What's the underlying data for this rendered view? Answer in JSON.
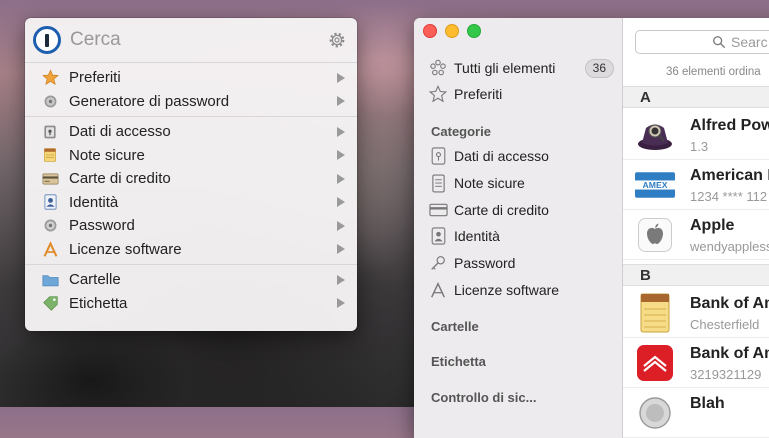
{
  "mini": {
    "search_placeholder": "Cerca",
    "groups": [
      [
        {
          "label": "Preferiti",
          "icon": "star-icon"
        },
        {
          "label": "Generatore di password",
          "icon": "gear-icon"
        }
      ],
      [
        {
          "label": "Dati di accesso",
          "icon": "login-icon"
        },
        {
          "label": "Note sicure",
          "icon": "note-icon"
        },
        {
          "label": "Carte di credito",
          "icon": "credit-card-icon"
        },
        {
          "label": "Identità",
          "icon": "identity-icon"
        },
        {
          "label": "Password",
          "icon": "password-icon"
        },
        {
          "label": "Licenze software",
          "icon": "software-license-icon"
        }
      ],
      [
        {
          "label": "Cartelle",
          "icon": "folder-icon"
        },
        {
          "label": "Etichetta",
          "icon": "tag-icon"
        }
      ]
    ]
  },
  "sidebar": {
    "all_items": {
      "label": "Tutti gli elementi",
      "count": "36"
    },
    "favorites": "Preferiti",
    "categories_header": "Categorie",
    "categories": [
      {
        "label": "Dati di accesso",
        "icon": "login-icon"
      },
      {
        "label": "Note sicure",
        "icon": "note-icon"
      },
      {
        "label": "Carte di credito",
        "icon": "credit-card-icon"
      },
      {
        "label": "Identità",
        "icon": "identity-icon"
      },
      {
        "label": "Password",
        "icon": "key-icon"
      },
      {
        "label": "Licenze software",
        "icon": "software-license-icon"
      }
    ],
    "folders_header": "Cartelle",
    "tags_header": "Etichetta",
    "security_header": "Controllo di sic..."
  },
  "list": {
    "search_placeholder": "Searc",
    "sort_text": "36 elementi ordina",
    "sections": [
      {
        "letter": "A",
        "entries": [
          {
            "title": "Alfred Pow",
            "sub": "1.3",
            "icon": "alfred-app-icon"
          },
          {
            "title": "American E",
            "sub": "1234 **** 112",
            "icon": "amex-card-icon"
          },
          {
            "title": "Apple",
            "sub": "wendyappless",
            "icon": "apple-logo-icon"
          }
        ]
      },
      {
        "letter": "B",
        "entries": [
          {
            "title": "Bank of Am",
            "sub": "Chesterfield",
            "icon": "note-icon"
          },
          {
            "title": "Bank of Am",
            "sub": "3219321129",
            "icon": "bank-logo-icon"
          },
          {
            "title": "Blah",
            "sub": "",
            "icon": "item-icon"
          }
        ]
      }
    ]
  }
}
